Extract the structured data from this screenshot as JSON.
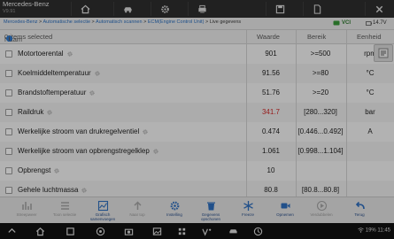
{
  "app": {
    "title": "Mercedes-Benz",
    "version": "V9.91"
  },
  "breadcrumb": {
    "items": [
      "Mercedes-Benz",
      "Automatische selectie",
      "Automatisch scannen",
      "ECM(Engine Control Unit)"
    ],
    "current": "Live gegevens",
    "separator": " > ",
    "vci_label": "VCI",
    "battery": "14.7V"
  },
  "table": {
    "columns": {
      "name": "Naam",
      "selected": "0 items selected",
      "value": "Waarde",
      "range": "Bereik",
      "unit": "Eenheid"
    },
    "rows": [
      {
        "name": "Motortoerental",
        "value": "901",
        "range": ">=500",
        "unit": "rpm",
        "alert": false
      },
      {
        "name": "Koelmiddeltemperatuur",
        "value": "91.56",
        "range": ">=80",
        "unit": "°C",
        "alert": false
      },
      {
        "name": "Brandstoftemperatuur",
        "value": "51.76",
        "range": ">=20",
        "unit": "°C",
        "alert": false
      },
      {
        "name": "Raildruk",
        "value": "341.7",
        "range": "[280...320]",
        "unit": "bar",
        "alert": true
      },
      {
        "name": "Werkelijke stroom van drukregelventiel",
        "value": "0.474",
        "range": "[0.446...0.492]",
        "unit": "A",
        "alert": false
      },
      {
        "name": "Werkelijke stroom van opbrengstregelklep",
        "value": "1.061",
        "range": "[0.998...1.104]",
        "unit": "",
        "alert": false
      },
      {
        "name": "Opbrengst",
        "value": "10",
        "range": "",
        "unit": "",
        "alert": false
      },
      {
        "name": "Gehele luchtmassa",
        "value": "80.8",
        "range": "[80.8...80.8]",
        "unit": "",
        "alert": false
      }
    ]
  },
  "toolbar": [
    {
      "label": "Streepweer",
      "enabled": false,
      "icon": "chart-icon"
    },
    {
      "label": "Toon selectie",
      "enabled": false,
      "icon": "list-icon"
    },
    {
      "label": "Grafisch samenvoegen",
      "enabled": true,
      "icon": "graph-icon"
    },
    {
      "label": "Naar top",
      "enabled": false,
      "icon": "arrow-up-icon"
    },
    {
      "label": "Instelling",
      "enabled": true,
      "icon": "settings-icon"
    },
    {
      "label": "Gegevens opschonen",
      "enabled": true,
      "icon": "trash-icon"
    },
    {
      "label": "Freeze",
      "enabled": true,
      "icon": "freeze-icon"
    },
    {
      "label": "Opnemen",
      "enabled": true,
      "icon": "record-icon"
    },
    {
      "label": "Verdubbelen",
      "enabled": false,
      "icon": "play-icon"
    },
    {
      "label": "Terug",
      "enabled": true,
      "icon": "back-icon"
    }
  ],
  "status": {
    "text": "19% 11:45"
  },
  "colors": {
    "alert": "#d22a2a",
    "accent": "#2f7bd1",
    "label_blue": "#2a4f8a"
  }
}
